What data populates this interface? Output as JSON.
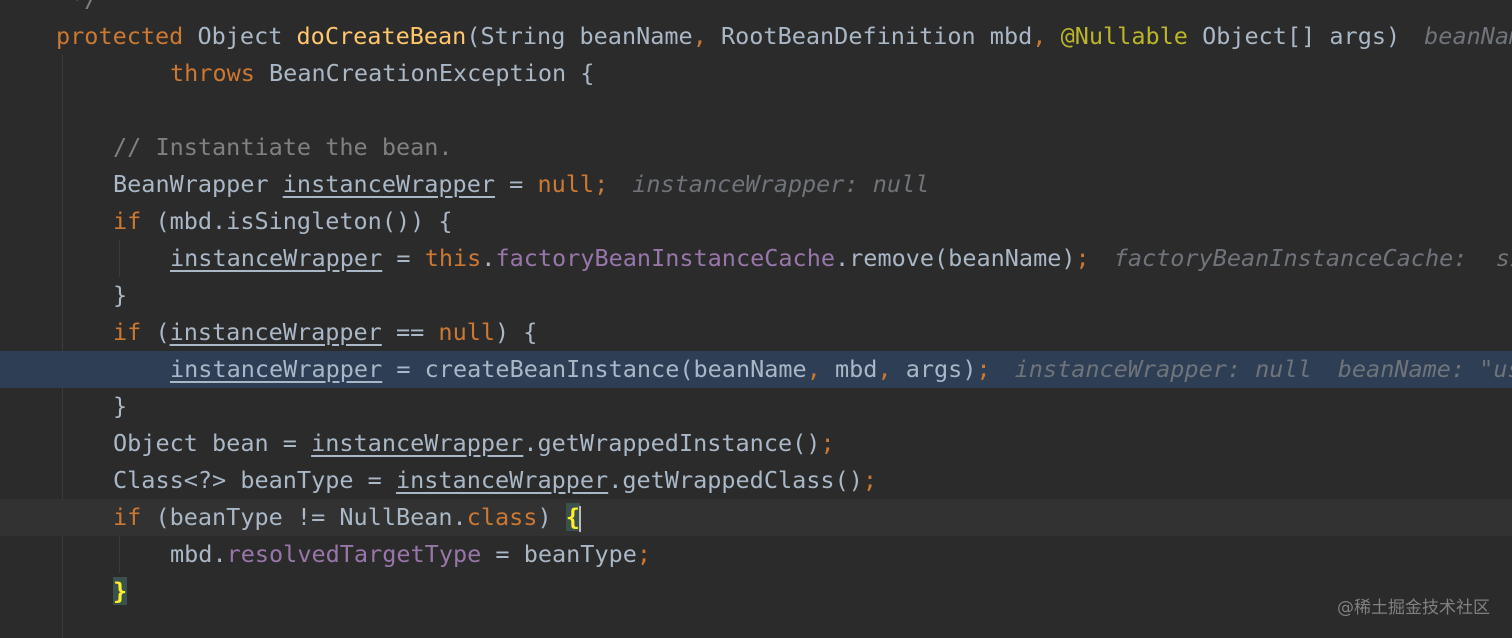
{
  "editor": {
    "lines": [
      {
        "tokens": [
          {
            "t": " */",
            "c": "comment"
          }
        ]
      },
      {
        "tokens": [
          {
            "t": "protected",
            "c": "kw"
          },
          {
            "t": " Object "
          },
          {
            "t": "doCreateBean",
            "c": "method"
          },
          {
            "t": "(String beanName"
          },
          {
            "t": ",",
            "c": "kw"
          },
          {
            "t": " RootBeanDefinition mbd"
          },
          {
            "t": ",",
            "c": "kw"
          },
          {
            "t": " "
          },
          {
            "t": "@Nullable",
            "c": "anno"
          },
          {
            "t": " Object[] args)"
          }
        ],
        "hints": [
          "beanName"
        ]
      },
      {
        "tokens": [
          {
            "t": "throws",
            "c": "kw"
          },
          {
            "t": " BeanCreationException {"
          }
        ]
      },
      {
        "tokens": []
      },
      {
        "tokens": [
          {
            "t": "// Instantiate the bean.",
            "c": "comment"
          }
        ]
      },
      {
        "tokens": [
          {
            "t": "BeanWrapper "
          },
          {
            "t": "instanceWrapper",
            "c": "local"
          },
          {
            "t": " = "
          },
          {
            "t": "null",
            "c": "kw"
          },
          {
            "t": ";",
            "c": "kw"
          }
        ],
        "hints": [
          "instanceWrapper: null"
        ]
      },
      {
        "tokens": [
          {
            "t": "if",
            "c": "kw"
          },
          {
            "t": " (mbd.isSingleton()) {"
          }
        ]
      },
      {
        "tokens": [
          {
            "t": "instanceWrapper",
            "c": "local"
          },
          {
            "t": " = "
          },
          {
            "t": "this",
            "c": "kw"
          },
          {
            "t": "."
          },
          {
            "t": "factoryBeanInstanceCache",
            "c": "field"
          },
          {
            "t": ".remove(beanName)"
          },
          {
            "t": ";",
            "c": "kw"
          }
        ],
        "hints": [
          "factoryBeanInstanceCache:  si"
        ]
      },
      {
        "tokens": [
          {
            "t": "}"
          }
        ]
      },
      {
        "tokens": [
          {
            "t": "if",
            "c": "kw"
          },
          {
            "t": " ("
          },
          {
            "t": "instanceWrapper",
            "c": "local"
          },
          {
            "t": " == "
          },
          {
            "t": "null",
            "c": "kw"
          },
          {
            "t": ") {"
          }
        ]
      },
      {
        "tokens": [
          {
            "t": "instanceWrapper",
            "c": "local"
          },
          {
            "t": " = createBeanInstance(beanName"
          },
          {
            "t": ",",
            "c": "kw"
          },
          {
            "t": " mbd"
          },
          {
            "t": ",",
            "c": "kw"
          },
          {
            "t": " args)"
          },
          {
            "t": ";",
            "c": "kw"
          }
        ],
        "hints": [
          "instanceWrapper: null",
          "beanName: \"us"
        ]
      },
      {
        "tokens": [
          {
            "t": "}"
          }
        ]
      },
      {
        "tokens": [
          {
            "t": "Object bean = "
          },
          {
            "t": "instanceWrapper",
            "c": "local"
          },
          {
            "t": ".getWrappedInstance()"
          },
          {
            "t": ";",
            "c": "kw"
          }
        ]
      },
      {
        "tokens": [
          {
            "t": "Class<?> beanType = "
          },
          {
            "t": "instanceWrapper",
            "c": "local"
          },
          {
            "t": ".getWrappedClass()"
          },
          {
            "t": ";",
            "c": "kw"
          }
        ]
      },
      {
        "tokens": [
          {
            "t": "if",
            "c": "kw"
          },
          {
            "t": " (beanType != NullBean."
          },
          {
            "t": "class",
            "c": "kw"
          },
          {
            "t": ") "
          },
          {
            "t": "{",
            "c": "brace-match"
          },
          {
            "t": "",
            "c": "caret"
          }
        ]
      },
      {
        "tokens": [
          {
            "t": "mbd."
          },
          {
            "t": "resolvedTargetType",
            "c": "field"
          },
          {
            "t": " = beanType"
          },
          {
            "t": ";",
            "c": "kw"
          }
        ]
      },
      {
        "tokens": [
          {
            "t": "}",
            "c": "brace-match"
          }
        ]
      }
    ]
  },
  "colors": {
    "background": "#2b2b2b",
    "execution_line": "#2d3e55",
    "caret_line": "#323232",
    "keyword": "#cc7832",
    "method": "#ffc66d",
    "field": "#9876aa",
    "annotation": "#bbb529",
    "comment": "#808080",
    "text": "#a9b7c6",
    "inline_hint": "#6f737a"
  },
  "watermark": "@稀土掘金技术社区"
}
